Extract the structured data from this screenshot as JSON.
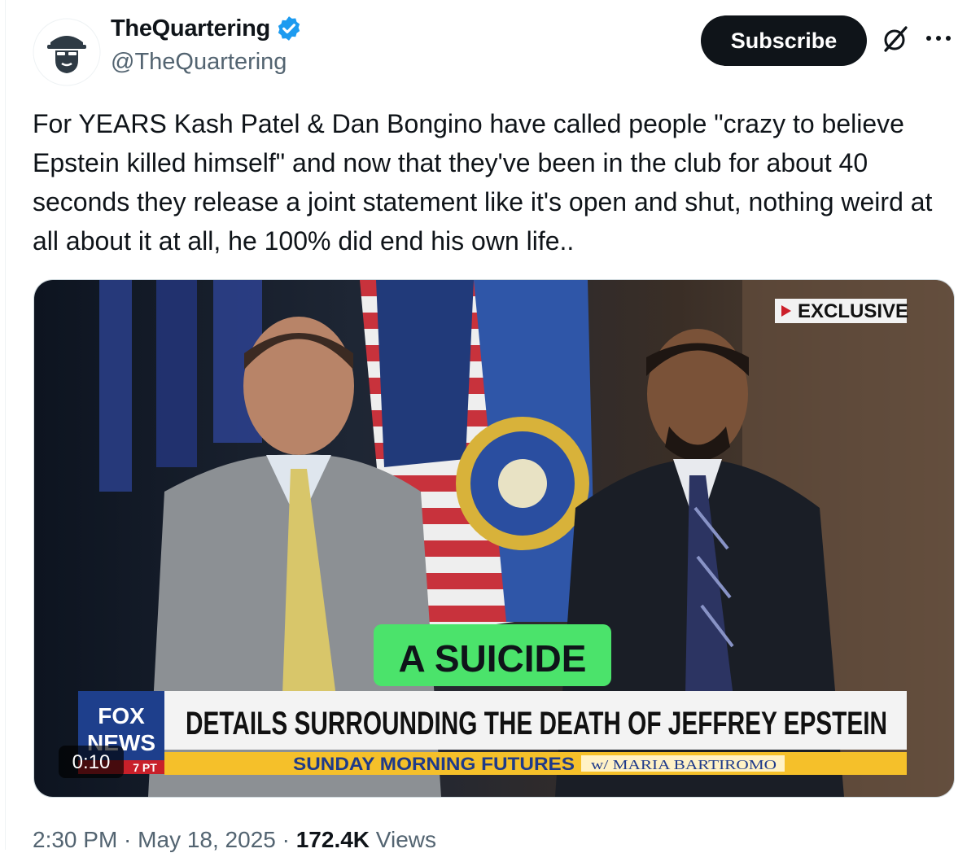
{
  "author": {
    "display_name": "TheQuartering",
    "handle": "@TheQuartering",
    "verified": true,
    "verified_color": "#1d9bf0"
  },
  "actions": {
    "subscribe_label": "Subscribe",
    "grok_icon": "grok-icon",
    "more_icon": "more-dots-icon"
  },
  "tweet": {
    "text": "For YEARS Kash Patel & Dan Bongino have called people \"crazy to believe Epstein killed himself\" and now that they've been in the club for about 40 seconds they release a joint statement like it's open and shut, nothing weird at all about it at all, he 100% did end his own life.."
  },
  "video": {
    "exclusive_label": "EXCLUSIVE",
    "caption": "A SUICIDE",
    "network_logo_line1": "FOX",
    "network_logo_line2": "NEWS",
    "time_zone_tag": "7 PT",
    "headline": "DETAILS SURROUNDING THE DEATH OF JEFFREY EPSTEIN",
    "show_name": "SUNDAY MORNING FUTURES",
    "show_host": "w/ MARIA BARTIROMO",
    "duration": "0:10",
    "caption_color": "#4be36b",
    "ticker_color": "#f5c02a"
  },
  "meta": {
    "time": "2:30 PM",
    "separator": " · ",
    "date": "May 18, 2025",
    "views_count": "172.4K",
    "views_label": " Views"
  }
}
